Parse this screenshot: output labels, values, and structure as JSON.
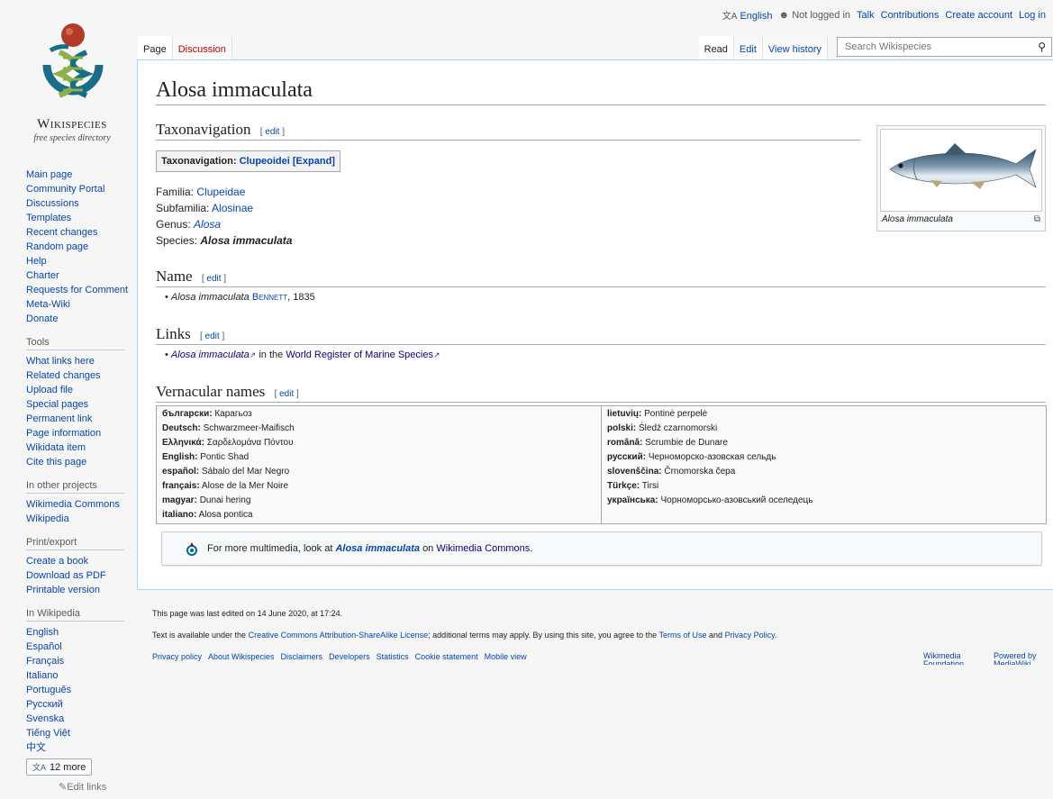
{
  "personal": {
    "language": "English",
    "not_logged_in": "Not logged in",
    "talk": "Talk",
    "contributions": "Contributions",
    "create_account": "Create account",
    "login": "Log in"
  },
  "logo": {
    "name": "Wikispecies",
    "tagline": "free species directory"
  },
  "sidebar": {
    "navigation": [
      "Main page",
      "Community Portal",
      "Discussions",
      "Templates",
      "Recent changes",
      "Random page",
      "Help",
      "Charter",
      "Requests for Comment",
      "Meta-Wiki",
      "Donate"
    ],
    "tools_heading": "Tools",
    "tools": [
      "What links here",
      "Related changes",
      "Upload file",
      "Special pages",
      "Permanent link",
      "Page information",
      "Wikidata item",
      "Cite this page"
    ],
    "projects_heading": "In other projects",
    "projects": [
      "Wikimedia Commons",
      "Wikipedia"
    ],
    "print_heading": "Print/export",
    "print": [
      "Create a book",
      "Download as PDF",
      "Printable version"
    ],
    "languages_heading": "In Wikipedia",
    "languages": [
      "English",
      "Español",
      "Français",
      "Italiano",
      "Português",
      "Русский",
      "Svenska",
      "Tiếng Việt",
      "中文"
    ],
    "more_languages": "12 more",
    "edit_links": "Edit links"
  },
  "tabs": {
    "page": "Page",
    "discussion": "Discussion",
    "read": "Read",
    "edit": "Edit",
    "history": "View history"
  },
  "search": {
    "placeholder": "Search Wikispecies"
  },
  "page": {
    "title": "Alosa immaculata",
    "edit_label": "edit",
    "taxonav_heading": "Taxonavigation",
    "taxonav_box_prefix": "Taxonavigation:",
    "taxonav_box_link": "Clupeoidei",
    "taxonav_box_expand": "[Expand]",
    "familia_label": "Familia:",
    "familia": "Clupeidae",
    "subfamilia_label": "Subfamilia:",
    "subfamilia": "Alosinae",
    "genus_label": "Genus:",
    "genus": "Alosa",
    "species_label": "Species:",
    "species": "Alosa immaculata",
    "image_caption": "Alosa immaculata",
    "name_heading": "Name",
    "name_species": "Alosa immaculata",
    "name_author": "Bennett",
    "name_year": ", 1835",
    "links_heading": "Links",
    "links_species": "Alosa immaculata",
    "links_middle": " in the ",
    "links_worms": "World Register of Marine Species",
    "vernacular_heading": "Vernacular names",
    "vernacular_left": [
      {
        "lang": "български:",
        "name": "Карагьоз"
      },
      {
        "lang": "Deutsch:",
        "name": "Schwarzmeer-Maifisch"
      },
      {
        "lang": "Ελληνικά:",
        "name": "Σαρδελομάνα Πόντου"
      },
      {
        "lang": "English:",
        "name": "Pontic Shad"
      },
      {
        "lang": "español:",
        "name": "Sábalo del Mar Negro"
      },
      {
        "lang": "français:",
        "name": "Alose de la Mer Noire"
      },
      {
        "lang": "magyar:",
        "name": "Dunai hering"
      },
      {
        "lang": "italiano:",
        "name": "Alosa pontica"
      }
    ],
    "vernacular_right": [
      {
        "lang": "lietuvių:",
        "name": "Pontinė perpelė"
      },
      {
        "lang": "polski:",
        "name": "Śledź czarnomorski"
      },
      {
        "lang": "română:",
        "name": "Scrumbie de Dunare"
      },
      {
        "lang": "русский:",
        "name": "Черноморско-азовская сельдь"
      },
      {
        "lang": "slovenščina:",
        "name": "Črnomorska čepa"
      },
      {
        "lang": "Türkçe:",
        "name": "Tirsi"
      },
      {
        "lang": "українська:",
        "name": "Чорноморсько-азовський оселедець"
      }
    ],
    "commons_prefix": "For more multimedia, look at",
    "commons_species": "Alosa immaculata",
    "commons_middle": "on",
    "commons_link": "Wikimedia Commons",
    "commons_suffix": "."
  },
  "footer": {
    "last_edited": "This page was last edited on 14 June 2020, at 17:24.",
    "license_prefix": "Text is available under the",
    "license_link": "Creative Commons Attribution-ShareAlike License",
    "license_middle": "; additional terms may apply. By using this site, you agree to the",
    "terms_link": "Terms of Use",
    "and": "and",
    "privacy_link": "Privacy Policy.",
    "places": [
      "Privacy policy",
      "About Wikispecies",
      "Disclaimers",
      "Developers",
      "Statistics",
      "Cookie statement",
      "Mobile view"
    ],
    "icon_wikimedia": "Wikimedia Foundation",
    "icon_mediawiki": "Powered by MediaWiki"
  },
  "colors": {
    "link": "#0645ad",
    "visited_link": "#0b0080",
    "content_border": "#a7d7f9",
    "background": "#f6f6f6"
  }
}
